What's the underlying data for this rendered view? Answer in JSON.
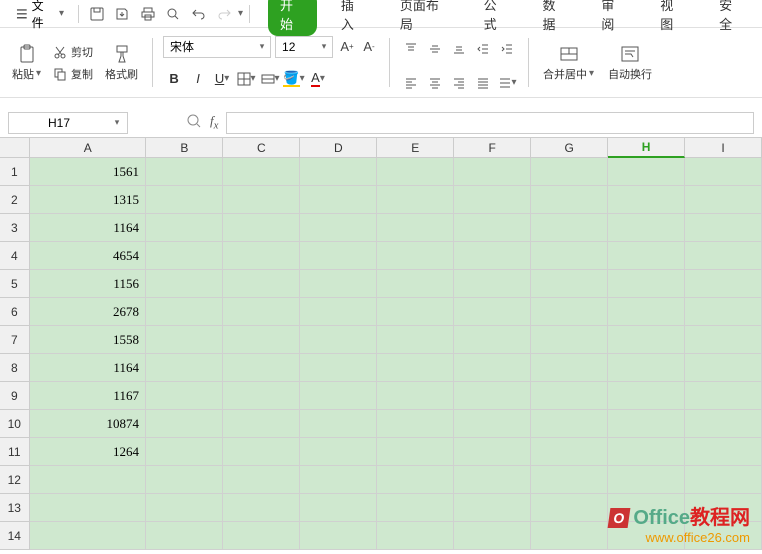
{
  "menu": {
    "file": "文件"
  },
  "tabs": [
    "开始",
    "插入",
    "页面布局",
    "公式",
    "数据",
    "审阅",
    "视图",
    "安全"
  ],
  "active_tab": 0,
  "toolbar": {
    "paste": "粘贴",
    "cut": "剪切",
    "copy": "复制",
    "format_painter": "格式刷",
    "merge_center": "合并居中",
    "wrap_text": "自动换行"
  },
  "font": {
    "name": "宋体",
    "size": "12"
  },
  "namebox": "H17",
  "formula": "",
  "columns": [
    "A",
    "B",
    "C",
    "D",
    "E",
    "F",
    "G",
    "H",
    "I"
  ],
  "selected_col": "H",
  "row_count": 14,
  "cells": {
    "A1": "1561",
    "A2": "1315",
    "A3": "1164",
    "A4": "4654",
    "A5": "1156",
    "A6": "2678",
    "A7": "1558",
    "A8": "1164",
    "A9": "1167",
    "A10": "10874",
    "A11": "1264"
  },
  "watermark": {
    "t1a": "Office",
    "t1b": "教程网",
    "t2": "www.office26.com"
  }
}
